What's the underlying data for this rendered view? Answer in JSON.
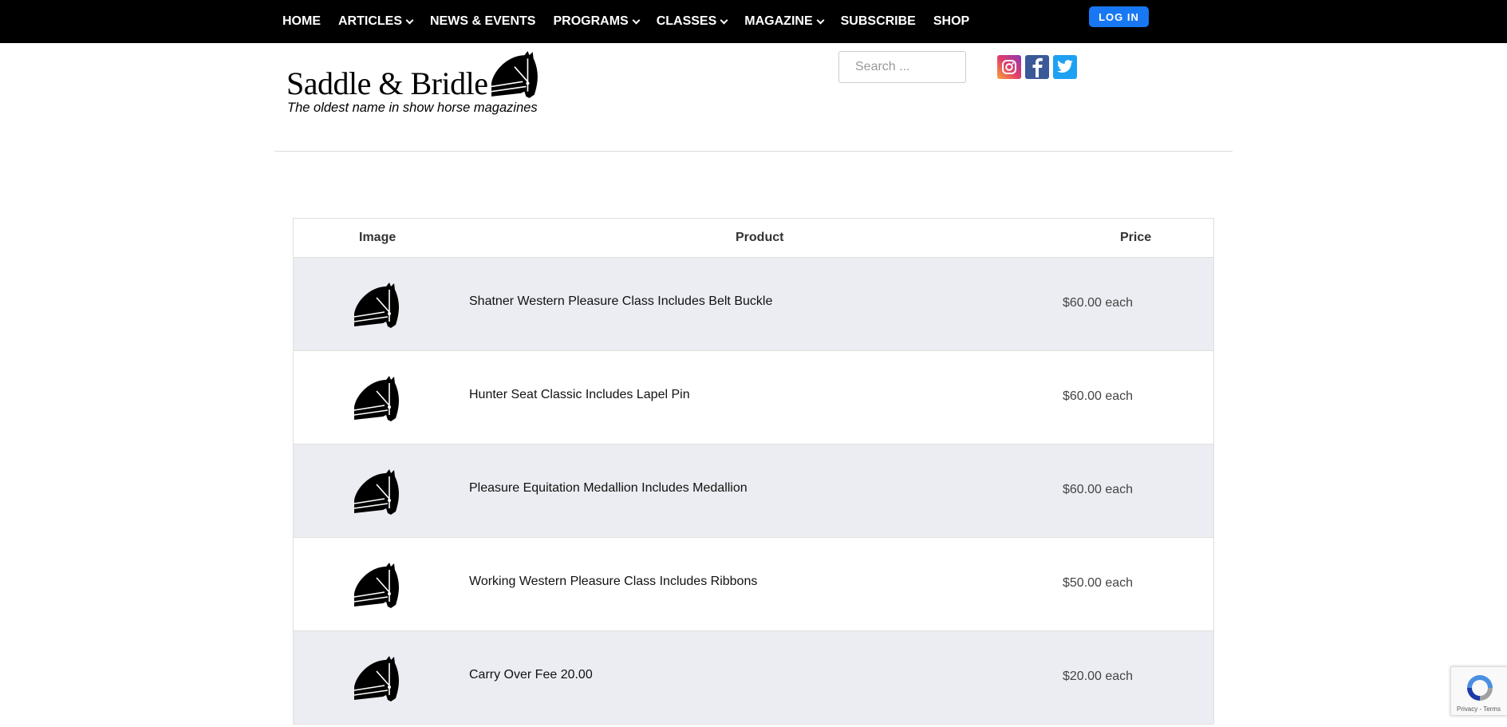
{
  "nav": {
    "items": [
      {
        "label": "HOME",
        "dropdown": false
      },
      {
        "label": "ARTICLES",
        "dropdown": true
      },
      {
        "label": "NEWS & EVENTS",
        "dropdown": false
      },
      {
        "label": "PROGRAMS",
        "dropdown": true
      },
      {
        "label": "CLASSES",
        "dropdown": true
      },
      {
        "label": "MAGAZINE",
        "dropdown": true
      },
      {
        "label": "SUBSCRIBE",
        "dropdown": false
      },
      {
        "label": "SHOP",
        "dropdown": false
      }
    ],
    "login_label": "LOG IN"
  },
  "logo": {
    "title": "Saddle & Bridle",
    "tagline": "The oldest name in show horse magazines"
  },
  "search": {
    "placeholder": "Search ...",
    "value": ""
  },
  "social": [
    {
      "name": "instagram-icon",
      "color": "#e13c6b"
    },
    {
      "name": "facebook-icon",
      "color": "#3b5998"
    },
    {
      "name": "twitter-icon",
      "color": "#1da1f2"
    }
  ],
  "table": {
    "headers": {
      "image": "Image",
      "product": "Product",
      "price": "Price"
    },
    "rows": [
      {
        "product": "Shatner Western Pleasure Class Includes Belt Buckle",
        "price": "$60.00 each"
      },
      {
        "product": "Hunter Seat Classic Includes Lapel Pin",
        "price": "$60.00 each"
      },
      {
        "product": "Pleasure Equitation Medallion Includes Medallion",
        "price": "$60.00 each"
      },
      {
        "product": "Working Western Pleasure Class Includes Ribbons",
        "price": "$50.00 each"
      },
      {
        "product": "Carry Over Fee 20.00",
        "price": "$20.00 each"
      }
    ]
  },
  "recaptcha": {
    "text": "Privacy - Terms"
  },
  "colors": {
    "topbar": "#000000",
    "login": "#1877f2",
    "row_alt": "#ebedf2"
  }
}
